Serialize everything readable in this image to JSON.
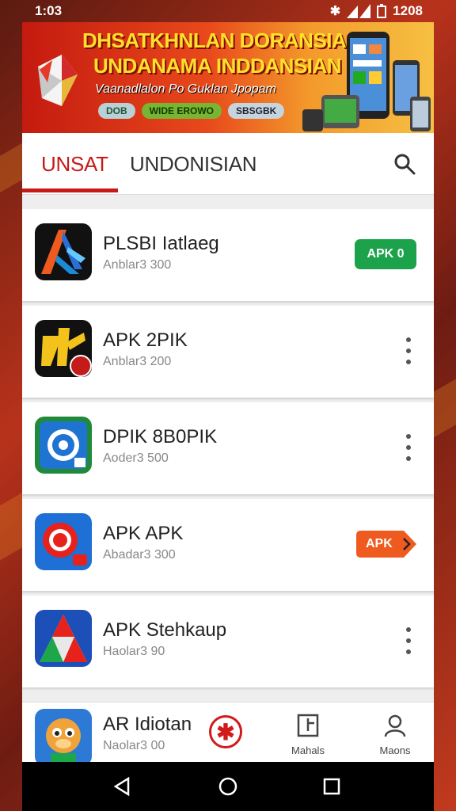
{
  "status_bar": {
    "time": "1:03",
    "battery": "1208"
  },
  "banner": {
    "title_line1": "DHSATKHNLAN DORANSIA",
    "title_line2": "UNDANAMA INDDANSIAN",
    "subtitle": "Vaanadlalon Po Guklan Jpopam",
    "pills": [
      "DOB",
      "WIDE EROWO",
      "SBSGBK"
    ]
  },
  "tabs": [
    {
      "label": "UNSAT",
      "active": true
    },
    {
      "label": "UNDONISIAN",
      "active": false
    }
  ],
  "apps": [
    {
      "name": "PLSBI Iatlaeg",
      "meta": "Anblar3 300",
      "action": "APK 0",
      "action_type": "green-button",
      "icon": "blue-arrow-app-icon"
    },
    {
      "name": "APK 2PIK",
      "meta": "Anblar3 200",
      "action": "",
      "action_type": "more",
      "icon": "yellow-star-app-icon"
    },
    {
      "name": "DPIK 8B0PIK",
      "meta": "Aoder3 500",
      "action": "",
      "action_type": "more",
      "icon": "gear-app-icon"
    },
    {
      "name": "APK  APK",
      "meta": "Abadar3 300",
      "action": "APK",
      "action_type": "orange-tag",
      "icon": "red-ring-app-icon"
    },
    {
      "name": "APK Stehkaup",
      "meta": "Haolar3 90",
      "action": "",
      "action_type": "more",
      "icon": "triangle-app-icon"
    }
  ],
  "bottom_nav": {
    "app": {
      "name": "AR Idiotan",
      "meta": "Naolar3 00"
    },
    "items": [
      {
        "label": "Mahals",
        "icon": "document-icon"
      },
      {
        "label": "Maons",
        "icon": "profile-icon"
      }
    ]
  },
  "colors": {
    "accent": "#c71a17",
    "banner": "#e8491b",
    "green": "#1ca24b",
    "orange": "#ef5a1f"
  }
}
